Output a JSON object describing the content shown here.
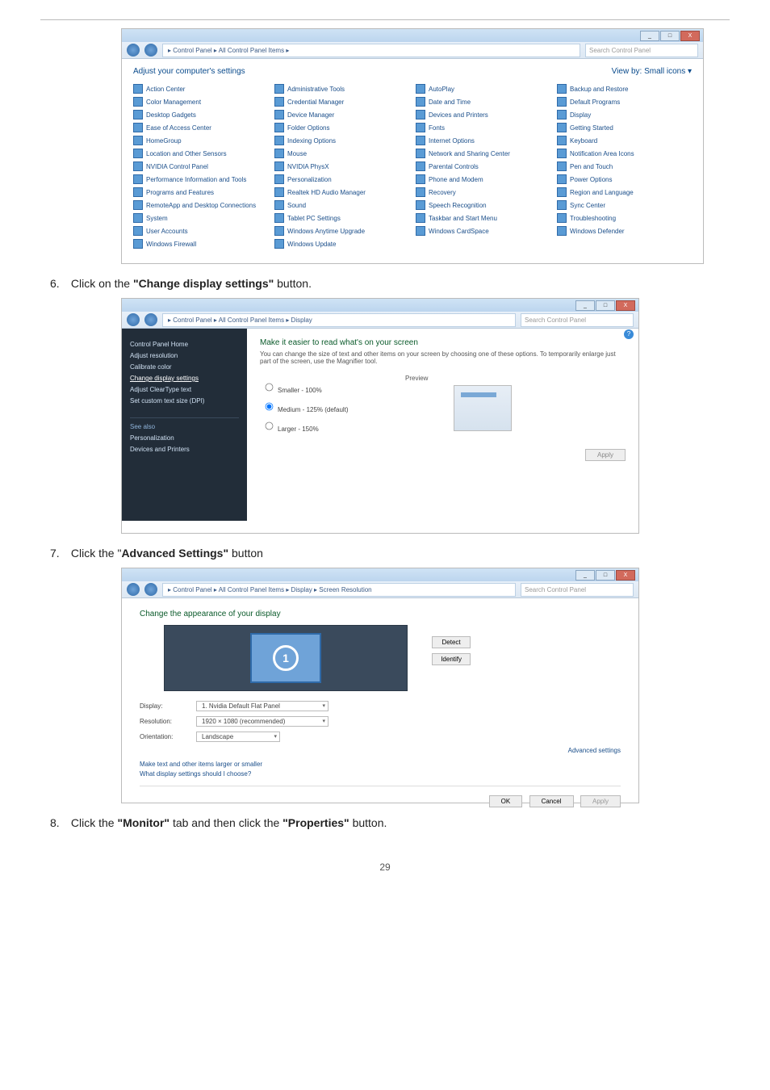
{
  "page_number": "29",
  "steps": {
    "s6": {
      "num": "6.",
      "text_a": "Click on the ",
      "bold": "\"Change display settings\"",
      "text_b": " button."
    },
    "s7": {
      "num": "7.",
      "text_a": "Click the \"",
      "bold": "Advanced Settings\"",
      "text_b": " button"
    },
    "s8": {
      "num": "8.",
      "text_a": "Click the ",
      "bold": "\"Monitor\"",
      "text_b": " tab and then click the ",
      "bold2": "\"Properties\"",
      "text_c": " button."
    }
  },
  "win_btns": {
    "min": "_",
    "max": "□",
    "close": "X"
  },
  "shot1": {
    "breadcrumb": "▸ Control Panel ▸ All Control Panel Items ▸",
    "search_ph": "Search Control Panel",
    "heading": "Adjust your computer's settings",
    "viewby": "View by:  Small icons ▾",
    "items": [
      "Action Center",
      "Administrative Tools",
      "AutoPlay",
      "Backup and Restore",
      "Color Management",
      "Credential Manager",
      "Date and Time",
      "Default Programs",
      "Desktop Gadgets",
      "Device Manager",
      "Devices and Printers",
      "Display",
      "Ease of Access Center",
      "Folder Options",
      "Fonts",
      "Getting Started",
      "HomeGroup",
      "Indexing Options",
      "Internet Options",
      "Keyboard",
      "Location and Other Sensors",
      "Mouse",
      "Network and Sharing Center",
      "Notification Area Icons",
      "NVIDIA Control Panel",
      "NVIDIA PhysX",
      "Parental Controls",
      "Pen and Touch",
      "Performance Information and Tools",
      "Personalization",
      "Phone and Modem",
      "Power Options",
      "Programs and Features",
      "Realtek HD Audio Manager",
      "Recovery",
      "Region and Language",
      "RemoteApp and Desktop Connections",
      "Sound",
      "Speech Recognition",
      "Sync Center",
      "System",
      "Tablet PC Settings",
      "Taskbar and Start Menu",
      "Troubleshooting",
      "User Accounts",
      "Windows Anytime Upgrade",
      "Windows CardSpace",
      "Windows Defender",
      "Windows Firewall",
      "Windows Update"
    ]
  },
  "shot2": {
    "breadcrumb": "▸ Control Panel ▸ All Control Panel Items ▸ Display",
    "search_ph": "Search Control Panel",
    "sidebar": {
      "home": "Control Panel Home",
      "links": [
        "Adjust resolution",
        "Calibrate color",
        "Change display settings",
        "Adjust ClearType text",
        "Set custom text size (DPI)"
      ],
      "current_idx": 2,
      "seealso": "See also",
      "see_links": [
        "Personalization",
        "Devices and Printers"
      ]
    },
    "main": {
      "title": "Make it easier to read what's on your screen",
      "desc": "You can change the size of text and other items on your screen by choosing one of these options. To temporarily enlarge just part of the screen, use the Magnifier tool.",
      "opts": [
        "Smaller - 100%",
        "Medium - 125% (default)",
        "Larger - 150%"
      ],
      "checked_idx": 1,
      "preview": "Preview",
      "apply": "Apply"
    }
  },
  "shot3": {
    "breadcrumb": "▸ Control Panel ▸ All Control Panel Items ▸ Display ▸ Screen Resolution",
    "search_ph": "Search Control Panel",
    "title": "Change the appearance of your display",
    "monitor_num": "1",
    "detect": "Detect",
    "identify": "Identify",
    "rows": {
      "display": {
        "label": "Display:",
        "value": "1. Nvidia Default Flat Panel"
      },
      "res": {
        "label": "Resolution:",
        "value": "1920 × 1080 (recommended)"
      },
      "orient": {
        "label": "Orientation:",
        "value": "Landscape"
      }
    },
    "advanced": "Advanced settings",
    "link1": "Make text and other items larger or smaller",
    "link2": "What display settings should I choose?",
    "ok": "OK",
    "cancel": "Cancel",
    "apply": "Apply"
  }
}
